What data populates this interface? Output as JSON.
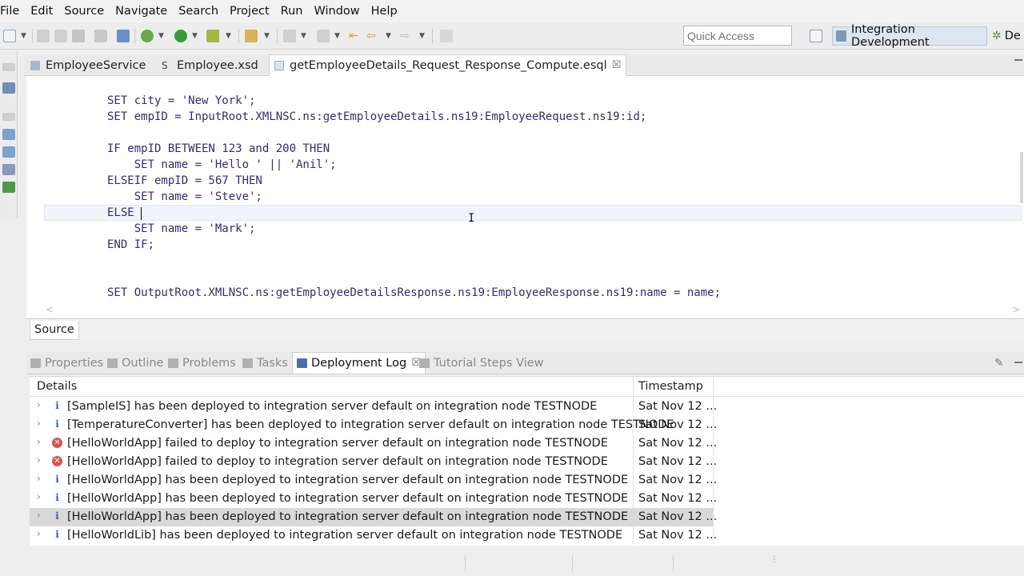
{
  "menu": [
    "File",
    "Edit",
    "Source",
    "Navigate",
    "Search",
    "Project",
    "Run",
    "Window",
    "Help"
  ],
  "toolbar": {
    "quick_access_placeholder": "Quick Access",
    "perspective_active": "Integration Development",
    "perspective_other": "De"
  },
  "editor": {
    "tabs": [
      {
        "label": "EmployeeService",
        "icon": "message-flow-icon"
      },
      {
        "label": "Employee.xsd",
        "icon": "xsd-file-icon"
      },
      {
        "label": "getEmployeeDetails_Request_Response_Compute.esql",
        "icon": "esql-file-icon",
        "active": true
      }
    ],
    "code_lines": [
      "SET city = 'New York';",
      "SET empID = InputRoot.XMLNSC.ns:getEmployeeDetails.ns19:EmployeeRequest.ns19:id;",
      "",
      "IF empID BETWEEN 123 and 200 THEN",
      "    SET name = 'Hello ' || 'Anil';",
      "ELSEIF empID = 567 THEN",
      "    SET name = 'Steve';",
      "ELSE",
      "    SET name = 'Mark';",
      "END IF;",
      "",
      "",
      "SET OutputRoot.XMLNSC.ns:getEmployeeDetailsResponse.ns19:EmployeeResponse.ns19:name = name;"
    ],
    "bottom_tab": "Source"
  },
  "panel": {
    "tabs": [
      {
        "label": "Properties",
        "icon": "properties-icon"
      },
      {
        "label": "Outline",
        "icon": "outline-icon"
      },
      {
        "label": "Problems",
        "icon": "problems-icon"
      },
      {
        "label": "Tasks",
        "icon": "tasks-icon"
      },
      {
        "label": "Deployment Log",
        "icon": "deployment-log-icon",
        "active": true
      },
      {
        "label": "Tutorial Steps View",
        "icon": "tutorial-icon"
      }
    ],
    "columns": [
      "Details",
      "Timestamp"
    ],
    "rows": [
      {
        "severity": "info",
        "details": "[SampleIS] has been deployed to integration server default on integration node TESTNODE",
        "timestamp": "Sat Nov 12 ..."
      },
      {
        "severity": "info",
        "details": "[TemperatureConverter] has been deployed to integration server default on integration node TESTNODE",
        "timestamp": "Sat Nov 12 ..."
      },
      {
        "severity": "error",
        "details": "[HelloWorldApp] failed to deploy to integration server default on integration node TESTNODE",
        "timestamp": "Sat Nov 12 ..."
      },
      {
        "severity": "error",
        "details": "[HelloWorldApp] failed to deploy to integration server default on integration node TESTNODE",
        "timestamp": "Sat Nov 12 ..."
      },
      {
        "severity": "info",
        "details": "[HelloWorldApp] has been deployed to integration server default on integration node TESTNODE",
        "timestamp": "Sat Nov 12 ..."
      },
      {
        "severity": "info",
        "details": "[HelloWorldApp] has been deployed to integration server default on integration node TESTNODE",
        "timestamp": "Sat Nov 12 ..."
      },
      {
        "severity": "info",
        "details": "[HelloWorldApp] has been deployed to integration server default on integration node TESTNODE",
        "timestamp": "Sat Nov 12 ...",
        "selected": true
      },
      {
        "severity": "info",
        "details": "[HelloWorldLib] has been deployed to integration server default on integration node TESTNODE",
        "timestamp": "Sat Nov 12 ..."
      }
    ]
  },
  "colors": {
    "current_line": "#f1f4fb",
    "code_text": "#3b2a66",
    "perspective_bg": "#dde6f0",
    "error": "#d9534f",
    "info": "#3a64a8"
  }
}
